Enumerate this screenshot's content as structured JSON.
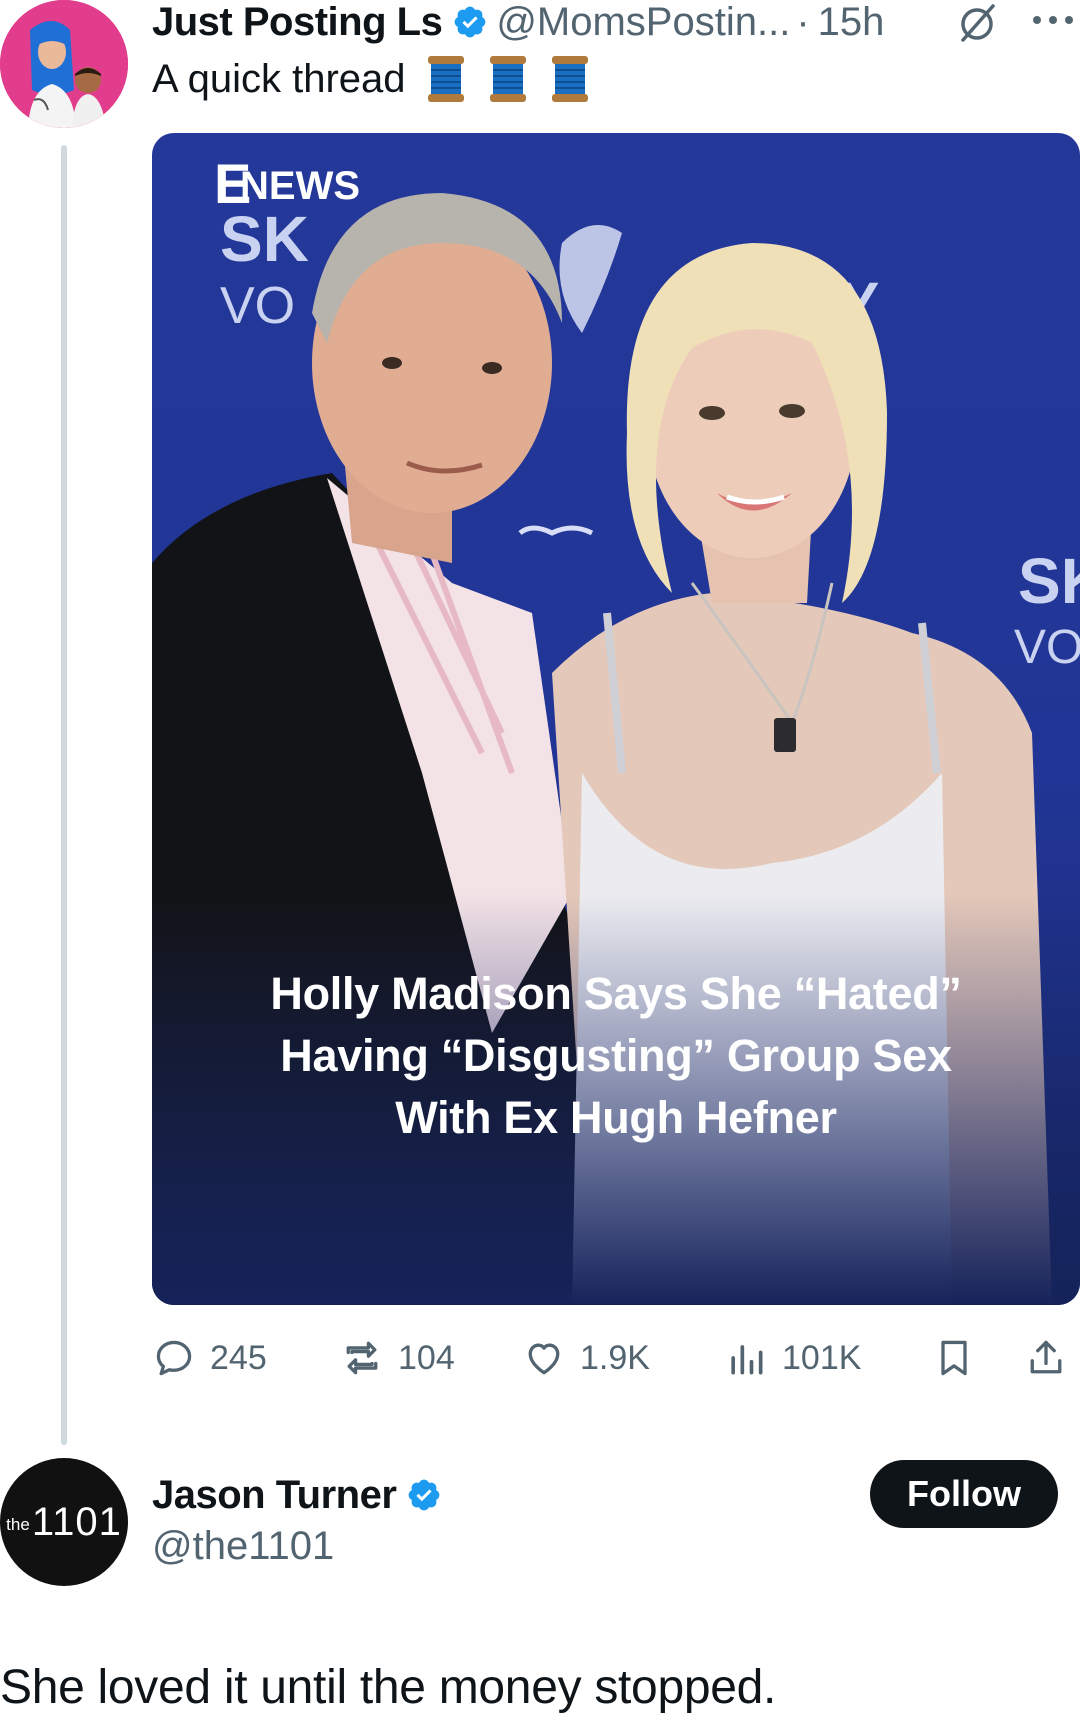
{
  "tweet": {
    "author_name": "Just Posting Ls",
    "author_handle": "@MomsPostin...",
    "separator": "·",
    "time": "15h",
    "text": "A quick thread",
    "emoji_icons": [
      "spool-of-thread-icon",
      "spool-of-thread-icon",
      "spool-of-thread-icon"
    ],
    "media": {
      "backdrop_text": [
        "E",
        "NEWS",
        "SK",
        "VO",
        "YY",
        "A",
        "SK",
        "VO"
      ],
      "headline_lines": [
        "Holly Madison Says She “Hated”",
        "Having “Disgusting” Group Sex",
        "With Ex Hugh Hefner"
      ]
    },
    "actions": {
      "replies": "245",
      "reposts": "104",
      "likes": "1.9K",
      "views": "101K"
    }
  },
  "reply": {
    "author_name": "Jason Turner",
    "author_handle": "@the1101",
    "avatar_text": {
      "prefix": "the",
      "number": "1101"
    },
    "follow_label": "Follow",
    "text": "She loved it until the money stopped."
  },
  "colors": {
    "verified_blue": "#1d9bf0",
    "muted_text": "#536471",
    "thread_line": "#cfd9de",
    "media_blue": "#24389a",
    "avatar_pink": "#e23d8c"
  }
}
